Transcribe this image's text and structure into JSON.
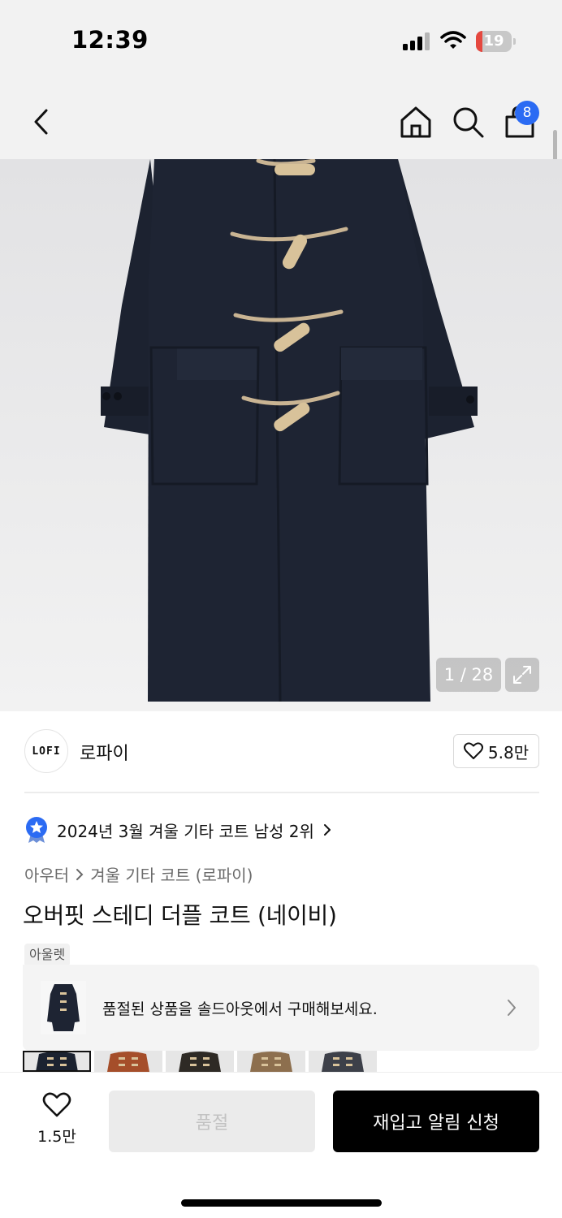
{
  "status_bar": {
    "time": "12:39",
    "battery_level": "19",
    "battery_fraction": 0.19,
    "battery_color": "#e5483f"
  },
  "nav": {
    "back_icon": "chevron-left-icon",
    "home_icon": "home-icon",
    "search_icon": "search-icon",
    "cart_icon": "shopping-bag-icon",
    "cart_count": "8",
    "badge_color": "#2b6bf3"
  },
  "gallery": {
    "counter": "1 / 28",
    "expand_icon": "expand-icon"
  },
  "brand": {
    "logo_text": "LOFI",
    "name": "로파이",
    "like_count": "5.8만"
  },
  "ranking": {
    "text": "2024년 3월 겨울 기타 코트 남성 2위",
    "badge_icon": "star-badge-icon",
    "badge_color": "#2b6bf3"
  },
  "breadcrumb": {
    "items": [
      "아우터",
      "겨울 기타 코트 (로파이)"
    ]
  },
  "product": {
    "title": "오버핏 스테디 더플 코트 (네이비)"
  },
  "outlet": {
    "tag": "아울렛",
    "message": "품절된 상품을 솔드아웃에서 구매해보세요."
  },
  "swatches": [
    {
      "color": "#1b2230",
      "selected": true
    },
    {
      "color": "#a54e2a",
      "selected": false
    },
    {
      "color": "#2e2a25",
      "selected": false
    },
    {
      "color": "#8d6f4e",
      "selected": false
    },
    {
      "color": "#3d4049",
      "selected": false
    }
  ],
  "bottom_bar": {
    "wish_count": "1.5만",
    "sold_out_label": "품절",
    "restock_label": "재입고 알림 신청"
  }
}
